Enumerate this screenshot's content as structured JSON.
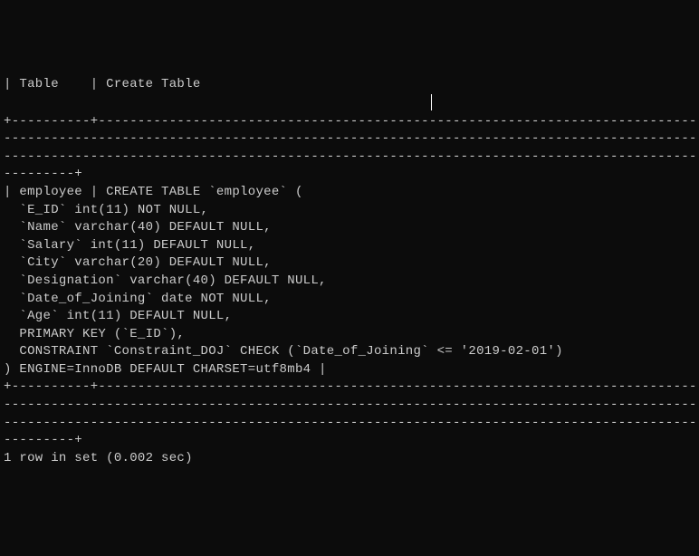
{
  "terminal": {
    "lines": [
      "| Table    | Create Table",
      "",
      "",
      "                                                      ",
      "+----------+----------------------------------------------------------------------------------",
      "------------------------------------------------------------------------------------------------",
      "------------------------------------------------------------------------------------------------",
      "---------+",
      "| employee | CREATE TABLE `employee` (",
      "  `E_ID` int(11) NOT NULL,",
      "  `Name` varchar(40) DEFAULT NULL,",
      "  `Salary` int(11) DEFAULT NULL,",
      "  `City` varchar(20) DEFAULT NULL,",
      "  `Designation` varchar(40) DEFAULT NULL,",
      "  `Date_of_Joining` date NOT NULL,",
      "  `Age` int(11) DEFAULT NULL,",
      "  PRIMARY KEY (`E_ID`),",
      "  CONSTRAINT `Constraint_DOJ` CHECK (`Date_of_Joining` <= '2019-02-01')",
      ") ENGINE=InnoDB DEFAULT CHARSET=utf8mb4 |",
      "+----------+----------------------------------------------------------------------------------",
      "------------------------------------------------------------------------------------------------",
      "------------------------------------------------------------------------------------------------",
      "---------+",
      "1 row in set (0.002 sec)",
      ""
    ],
    "cursor_line_index": 3
  },
  "chart_data": {
    "type": "table",
    "title": "SHOW CREATE TABLE employee",
    "columns": [
      "Table",
      "Create Table"
    ],
    "rows": [
      {
        "Table": "employee",
        "Create Table": "CREATE TABLE `employee` (\n  `E_ID` int(11) NOT NULL,\n  `Name` varchar(40) DEFAULT NULL,\n  `Salary` int(11) DEFAULT NULL,\n  `City` varchar(20) DEFAULT NULL,\n  `Designation` varchar(40) DEFAULT NULL,\n  `Date_of_Joining` date NOT NULL,\n  `Age` int(11) DEFAULT NULL,\n  PRIMARY KEY (`E_ID`),\n  CONSTRAINT `Constraint_DOJ` CHECK (`Date_of_Joining` <= '2019-02-01')\n) ENGINE=InnoDB DEFAULT CHARSET=utf8mb4"
      }
    ],
    "footer": "1 row in set (0.002 sec)"
  }
}
